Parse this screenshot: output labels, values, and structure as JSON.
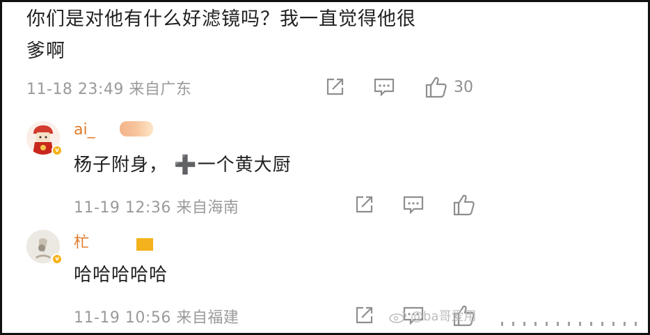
{
  "post": {
    "text_line1": "你们是对他有什么好滤镜吗？我一直觉得他很",
    "text_line2": "爹啊",
    "timestamp": "11-18 23:49",
    "location": "来自广东",
    "like_count": "30"
  },
  "replies": [
    {
      "username": "ai_",
      "text": "杨子附身， ➕一个黄大厨",
      "timestamp": "11-19 12:36",
      "location": "来自海南"
    },
    {
      "username": "杧",
      "text": "哈哈哈哈哈",
      "timestamp": "11-19 10:56",
      "location": "来自福建"
    }
  ],
  "watermark": "@ba哥爱用",
  "icons": [
    "share-icon",
    "comment-icon",
    "like-icon",
    "verified-icon"
  ],
  "colors": {
    "username": "#e07b2b",
    "meta": "#9a9a9a",
    "verified": "#f6b21b"
  }
}
